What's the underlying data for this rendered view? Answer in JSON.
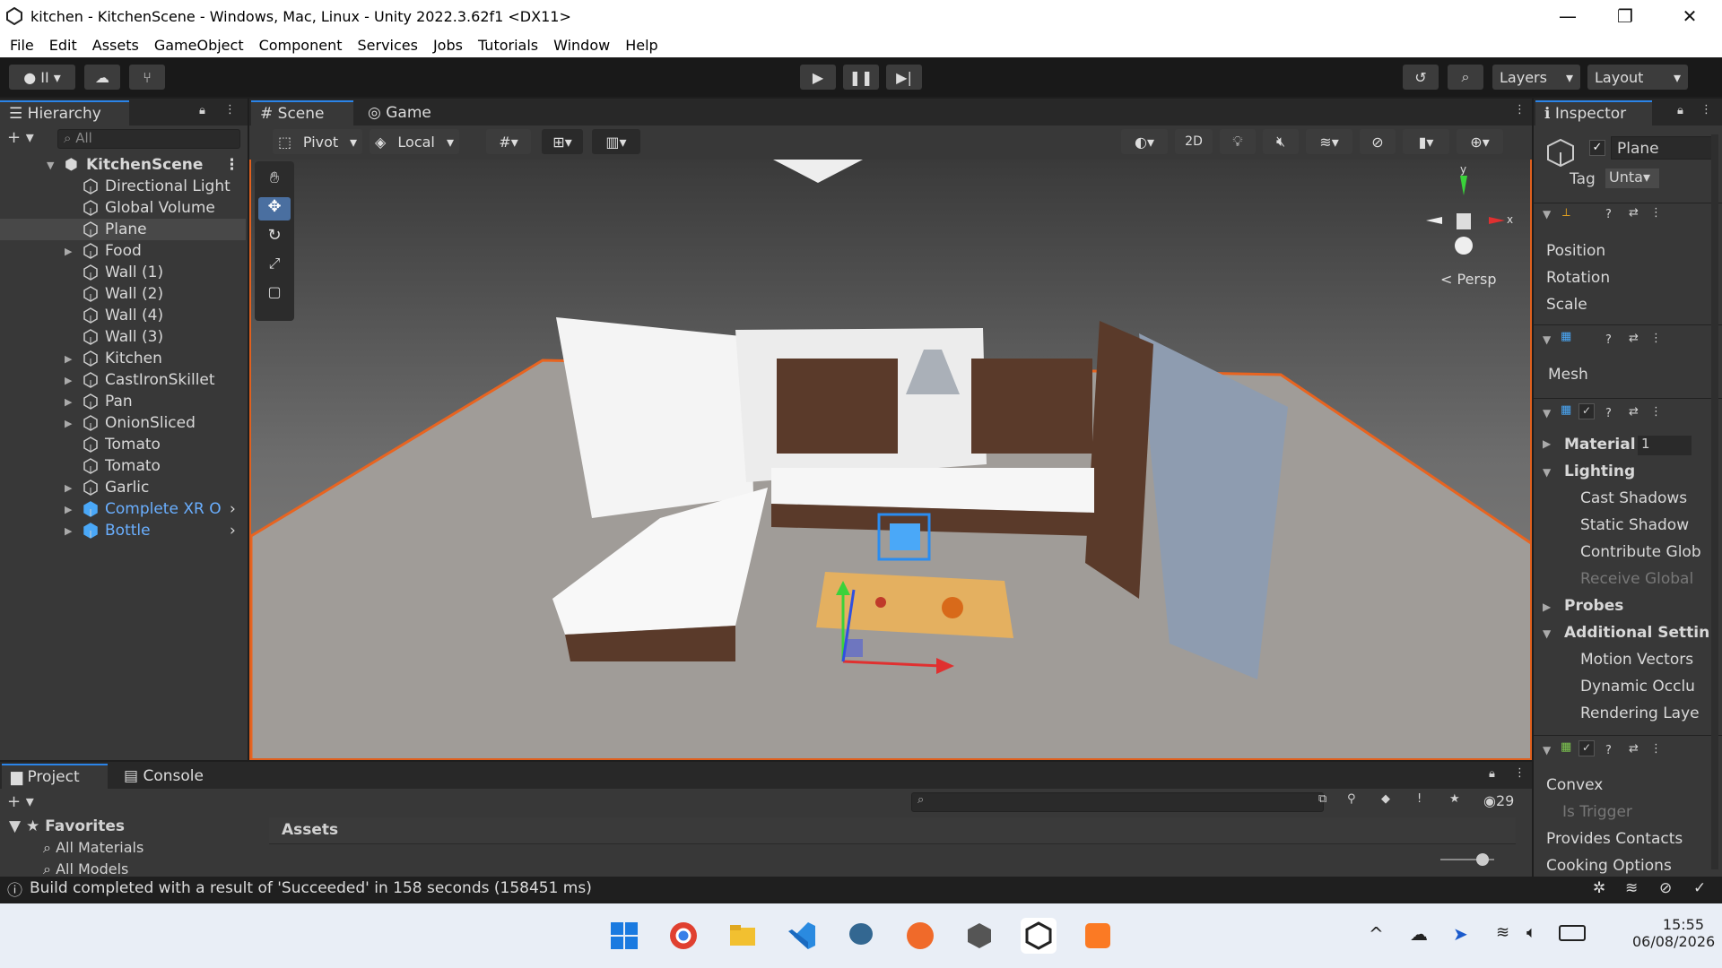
{
  "window": {
    "title": "kitchen - KitchenScene - Windows, Mac, Linux - Unity 2022.3.62f1 <DX11>",
    "controls": [
      "—",
      "❐",
      "✕"
    ]
  },
  "menu": [
    "File",
    "Edit",
    "Assets",
    "GameObject",
    "Component",
    "Services",
    "Jobs",
    "Tutorials",
    "Window",
    "Help"
  ],
  "toolbar": {
    "account_label": "II",
    "layers_label": "Layers",
    "layout_label": "Layout"
  },
  "hierarchy": {
    "tab": "Hierarchy",
    "search_placeholder": "All",
    "scene_name": "KitchenScene",
    "items": [
      {
        "label": "Directional Light",
        "expandable": false
      },
      {
        "label": "Global Volume",
        "expandable": false
      },
      {
        "label": "Plane",
        "expandable": false,
        "selected": true
      },
      {
        "label": "Food",
        "expandable": true
      },
      {
        "label": "Wall (1)",
        "expandable": false
      },
      {
        "label": "Wall (2)",
        "expandable": false
      },
      {
        "label": "Wall (4)",
        "expandable": false
      },
      {
        "label": "Wall (3)",
        "expandable": false
      },
      {
        "label": "Kitchen",
        "expandable": true
      },
      {
        "label": "CastIronSkillet",
        "expandable": true
      },
      {
        "label": "Pan",
        "expandable": true
      },
      {
        "label": "OnionSliced",
        "expandable": true
      },
      {
        "label": "Tomato",
        "expandable": false
      },
      {
        "label": "Tomato",
        "expandable": false
      },
      {
        "label": "Garlic",
        "expandable": true
      },
      {
        "label": "Complete XR O",
        "expandable": true,
        "prefab": true
      },
      {
        "label": "Bottle",
        "expandable": true,
        "prefab": true
      }
    ]
  },
  "scene": {
    "tabs": [
      "Scene",
      "Game"
    ],
    "pivot_label": "Pivot",
    "local_label": "Local",
    "mode_2d": "2D",
    "persp_label": "Persp",
    "gizmo_x": "x",
    "gizmo_y": "y"
  },
  "inspector": {
    "tab": "Inspector",
    "object_name": "Plane",
    "tag_label": "Tag",
    "tag_value": "Unta",
    "transform": {
      "position": "Position",
      "rotation": "Rotation",
      "scale": "Scale"
    },
    "mesh_label": "Mesh",
    "materials_label": "Material",
    "materials_value": "1",
    "lighting_label": "Lighting",
    "lighting_items": [
      "Cast Shadows",
      "Static Shadow",
      "Contribute Glob",
      "Receive Global"
    ],
    "probes_label": "Probes",
    "additional_label": "Additional Settin",
    "additional_items": [
      "Motion Vectors",
      "Dynamic Occlu",
      "Rendering Laye"
    ],
    "collider": {
      "convex": "Convex",
      "is_trigger": "Is Trigger",
      "provides_contacts": "Provides Contacts",
      "cooking": "Cooking Options"
    }
  },
  "project": {
    "tabs": [
      "Project",
      "Console"
    ],
    "favorites": "Favorites",
    "fav_items": [
      "All Materials",
      "All Models"
    ],
    "assets_label": "Assets",
    "hidden_count": "29"
  },
  "status": {
    "message": "Build completed with a result of 'Succeeded' in 158 seconds (158451 ms)"
  },
  "taskbar": {
    "time": "15:55",
    "date": "06/08/2026"
  }
}
